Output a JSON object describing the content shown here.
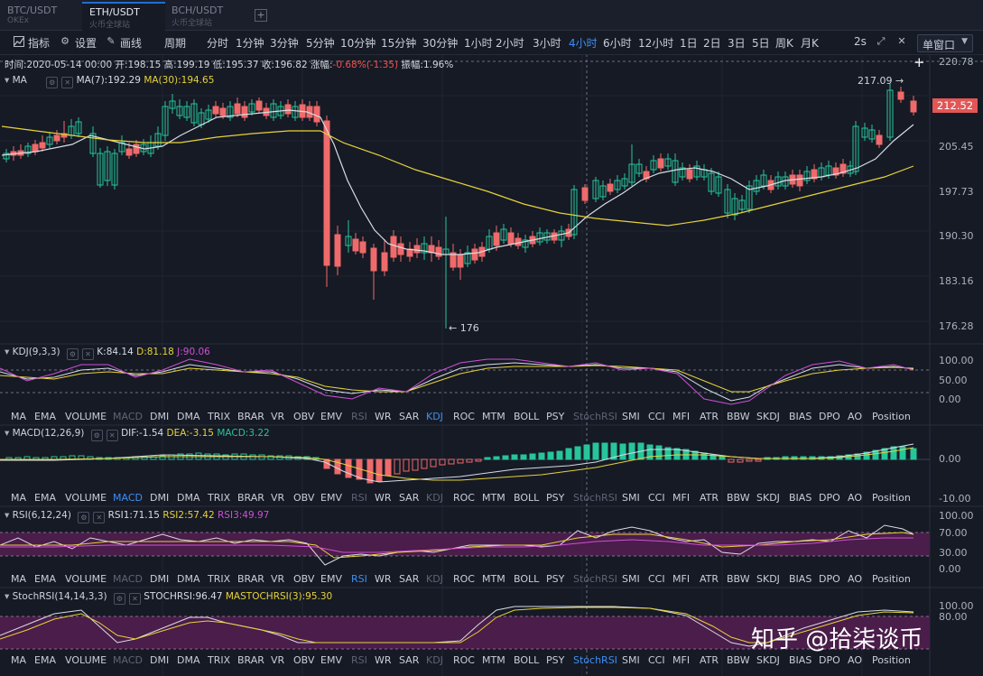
{
  "tabs": [
    {
      "pair": "BTC/USDT",
      "exchange": "OKEx"
    },
    {
      "pair": "ETH/USDT",
      "exchange": "火币全球站"
    },
    {
      "pair": "BCH/USDT",
      "exchange": "火币全球站"
    }
  ],
  "tab_add_label": "+",
  "toolbar": {
    "indicator_label": "指标",
    "settings_label": "设置",
    "draw_label": "画线",
    "period_label": "周期",
    "periods": [
      "分时",
      "1分钟",
      "3分钟",
      "5分钟",
      "10分钟",
      "15分钟",
      "30分钟",
      "1小时",
      "2小时",
      "3小时",
      "4小时",
      "6小时",
      "12小时",
      "1日",
      "2日",
      "3日",
      "5日",
      "周K",
      "月K"
    ],
    "active_period": "4小时",
    "timer_label": "2s",
    "window_select": "单窗口"
  },
  "info_line": {
    "time": "时间:2020-05-14 00:00",
    "open": "开:198.15",
    "high": "高:199.19",
    "low": "低:195.37",
    "close": "收:196.82",
    "change_label": "涨幅:",
    "change_value": "-0.68%(-1.35)",
    "amplitude": "振幅:1.96%"
  },
  "main_chart": {
    "ma_label": "MA",
    "ma7": "MA(7):192.29",
    "ma30": "MA(30):194.65",
    "y_ticks": [
      "220.78",
      "205.45",
      "197.73",
      "190.30",
      "183.16",
      "176.28"
    ],
    "current_price": "212.52",
    "high_marker": "217.09",
    "low_marker": "176",
    "colors": {
      "up": "#26c59a",
      "down": "#ef6a6a",
      "ma7": "#d8dce4",
      "ma30": "#e6d23a"
    }
  },
  "kdj": {
    "title": "KDJ(9,3,3)",
    "k": "K:84.14",
    "d": "D:81.18",
    "j": "J:90.06",
    "y_ticks": [
      "100.00",
      "50.00",
      "0.00"
    ]
  },
  "macd": {
    "title": "MACD(12,26,9)",
    "dif": "DIF:-1.54",
    "dea": "DEA:-3.15",
    "macd": "MACD:3.22",
    "y_ticks": [
      "0.00",
      "-10.00"
    ]
  },
  "rsi": {
    "title": "RSI(6,12,24)",
    "rsi1": "RSI1:71.15",
    "rsi2": "RSI2:57.42",
    "rsi3": "RSI3:49.97",
    "y_ticks": [
      "100.00",
      "70.00",
      "30.00",
      "0.00"
    ]
  },
  "stochrsi": {
    "title": "StochRSI(14,14,3,3)",
    "stoch": "STOCHRSI:96.47",
    "ma": "MASTOCHRSI(3):95.30",
    "y_ticks": [
      "100.00",
      "80.00"
    ]
  },
  "indicator_tabs": [
    "MA",
    "EMA",
    "VOLUME",
    "MACD",
    "DMI",
    "DMA",
    "TRIX",
    "BRAR",
    "VR",
    "OBV",
    "EMV",
    "RSI",
    "WR",
    "SAR",
    "KDJ",
    "ROC",
    "MTM",
    "BOLL",
    "PSY",
    "StochRSI",
    "SMI",
    "CCI",
    "MFI",
    "ATR",
    "BBW",
    "SKDJ",
    "BIAS",
    "DPO",
    "AO",
    "Position"
  ],
  "watermark": "知乎 @拾柒谈币"
}
